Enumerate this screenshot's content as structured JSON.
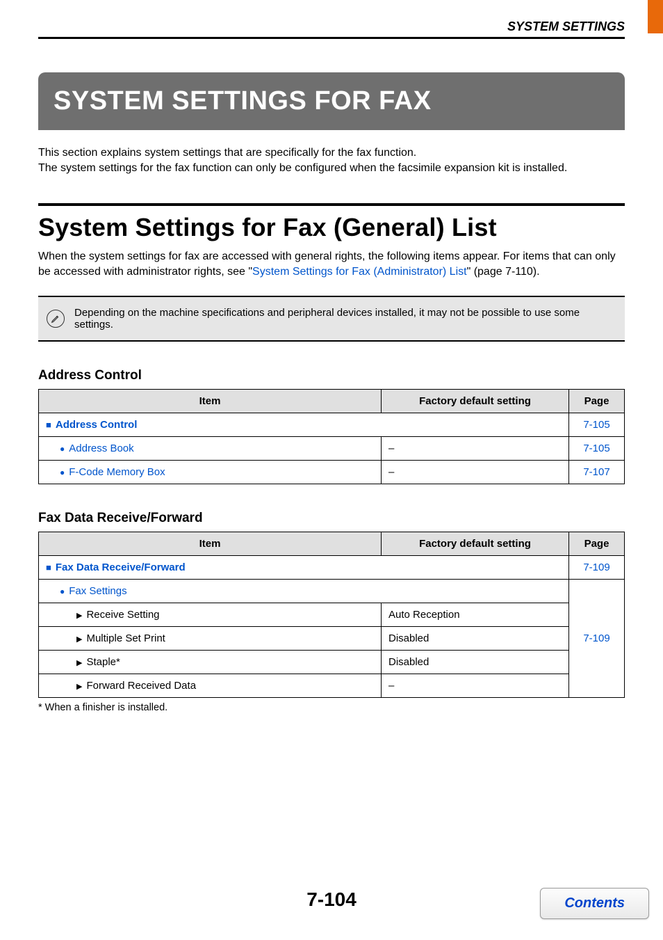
{
  "header": {
    "breadcrumb": "SYSTEM SETTINGS"
  },
  "main_title": "SYSTEM SETTINGS FOR FAX",
  "intro": {
    "line1": "This section explains system settings that are specifically for the fax function.",
    "line2": "The system settings for the fax function can only be configured when the facsimile expansion kit is installed."
  },
  "section": {
    "title": "System Settings for Fax (General) List",
    "intro_part1": "When the system settings for fax are accessed with general rights, the following items appear. For items that can only be accessed with administrator rights, see \"",
    "intro_link": "System Settings for Fax (Administrator) List",
    "intro_part2": "\" (page 7-110)."
  },
  "note": "Depending on the machine specifications and peripheral devices installed, it may not be possible to use some settings.",
  "tables": {
    "headers": {
      "item": "Item",
      "factory_default": "Factory default setting",
      "page": "Page"
    },
    "address_control": {
      "title": "Address Control",
      "rows": [
        {
          "label": "Address Control",
          "page": "7-105"
        },
        {
          "label": "Address Book",
          "default": "–",
          "page": "7-105"
        },
        {
          "label": "F-Code Memory Box",
          "default": "–",
          "page": "7-107"
        }
      ]
    },
    "fax_data": {
      "title": "Fax Data Receive/Forward",
      "group_page": "7-109",
      "settings_page": "7-109",
      "rows": {
        "group": "Fax Data Receive/Forward",
        "settings": "Fax Settings",
        "receive": {
          "label": "Receive Setting",
          "default": "Auto Reception"
        },
        "multiple": {
          "label": "Multiple Set Print",
          "default": "Disabled"
        },
        "staple": {
          "label": "Staple*",
          "default": "Disabled"
        },
        "forward": {
          "label": "Forward Received Data",
          "default": "–"
        }
      }
    }
  },
  "footnote": "*  When a finisher is installed.",
  "page_number": "7-104",
  "contents_button": "Contents"
}
